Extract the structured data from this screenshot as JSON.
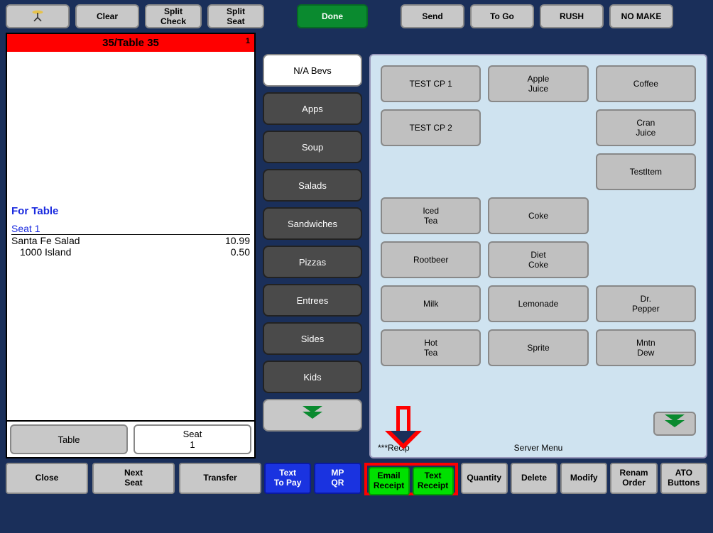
{
  "topbar": {
    "clear": "Clear",
    "split_check": "Split\nCheck",
    "split_seat": "Split\nSeat",
    "done": "Done",
    "send": "Send",
    "togo": "To Go",
    "rush": "RUSH",
    "nomake": "NO MAKE"
  },
  "ticket": {
    "header": "35/Table 35",
    "header_num": "1",
    "for_table": "For Table",
    "seat_label": "Seat 1",
    "lines": [
      {
        "name": "Santa Fe Salad",
        "price": "10.99"
      },
      {
        "name": "1000 Island",
        "price": "0.50"
      }
    ],
    "footer": {
      "table": "Table",
      "seat_label": "Seat",
      "seat_num": "1"
    }
  },
  "categories": [
    "N/A Bevs",
    "Apps",
    "Soup",
    "Salads",
    "Sandwiches",
    "Pizzas",
    "Entrees",
    "Sides",
    "Kids"
  ],
  "items_panel": {
    "footer_left": "***Recip",
    "footer_center": "Server Menu"
  },
  "items": [
    "TEST  CP 1",
    "Apple\nJuice",
    "Coffee",
    "TEST  CP 2",
    "",
    "Cran\nJuice",
    "",
    "",
    "TestItem",
    "Iced\nTea",
    "Coke",
    "",
    "Rootbeer",
    "Diet\nCoke",
    "",
    "Milk",
    "Lemonade",
    "Dr.\nPepper",
    "Hot\nTea",
    "Sprite",
    "Mntn\nDew"
  ],
  "bottom": {
    "close": "Close",
    "next_seat": "Next\nSeat",
    "transfer": "Transfer",
    "text_to_pay": "Text\nTo Pay",
    "mp_qr": "MP\nQR",
    "email_receipt": "Email\nReceipt",
    "text_receipt": "Text\nReceipt",
    "quantity": "Quantity",
    "delete": "Delete",
    "modify": "Modify",
    "rename_order": "Renam\nOrder",
    "ato_buttons": "ATO\nButtons"
  }
}
